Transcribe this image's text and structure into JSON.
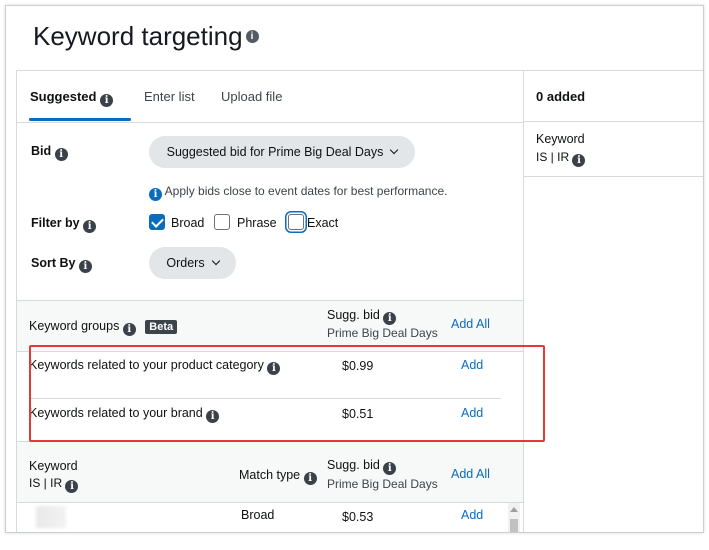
{
  "title": "Keyword targeting",
  "tabs": [
    {
      "label": "Suggested"
    },
    {
      "label": "Enter list"
    },
    {
      "label": "Upload file"
    }
  ],
  "bid": {
    "label": "Bid",
    "selected": "Suggested bid for Prime Big Deal Days",
    "hint": "Apply bids close to event dates for best performance."
  },
  "filter": {
    "label": "Filter by",
    "options": [
      {
        "label": "Broad",
        "checked": true
      },
      {
        "label": "Phrase",
        "checked": false
      },
      {
        "label": "Exact",
        "checked": false
      }
    ]
  },
  "sort": {
    "label": "Sort By",
    "selected": "Orders"
  },
  "groups": {
    "header": {
      "col1": "Keyword groups",
      "badge": "Beta",
      "col2_line1": "Sugg. bid",
      "col2_line2": "Prime Big Deal Days",
      "add_all": "Add All"
    },
    "rows": [
      {
        "name": "Keywords related to your product category",
        "bid": "$0.99",
        "action": "Add"
      },
      {
        "name": "Keywords related to your brand",
        "bid": "$0.51",
        "action": "Add"
      }
    ]
  },
  "keywords": {
    "header": {
      "col1_line1": "Keyword",
      "col1_line2": "IS | IR",
      "match": "Match type",
      "col3_line1": "Sugg. bid",
      "col3_line2": "Prime Big Deal Days",
      "add_all": "Add All"
    },
    "rows": [
      {
        "keyword": "",
        "match": "Broad",
        "bid": "$0.53",
        "action": "Add"
      }
    ]
  },
  "added": {
    "count_label": "0 added",
    "col_line1": "Keyword",
    "col_line2": "IS | IR"
  },
  "colors": {
    "accent": "#0a6cbd",
    "highlight": "#e23b36"
  }
}
